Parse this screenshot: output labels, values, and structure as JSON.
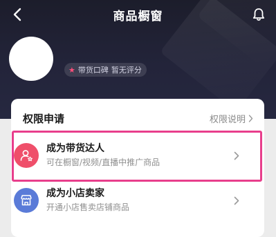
{
  "header": {
    "title": "商品橱窗",
    "back_icon": "chevron-left-icon",
    "notification_icon": "bell-icon"
  },
  "profile": {
    "badge_label": "带货口碑",
    "badge_value": "暂无评分"
  },
  "permissions": {
    "title": "权限申请",
    "help_link": "权限说明",
    "options": [
      {
        "title": "成为带货达人",
        "subtitle": "可在橱窗/视频/直播中推广商品",
        "icon": "user-star-icon",
        "icon_bg": "#ef4f6a"
      },
      {
        "title": "成为小店卖家",
        "subtitle": "开通小店售卖店铺商品",
        "icon": "shop-icon",
        "icon_bg": "#5a7bd8"
      }
    ]
  },
  "colors": {
    "highlight": "#e83e8c",
    "header_bg": "#1f2030"
  }
}
